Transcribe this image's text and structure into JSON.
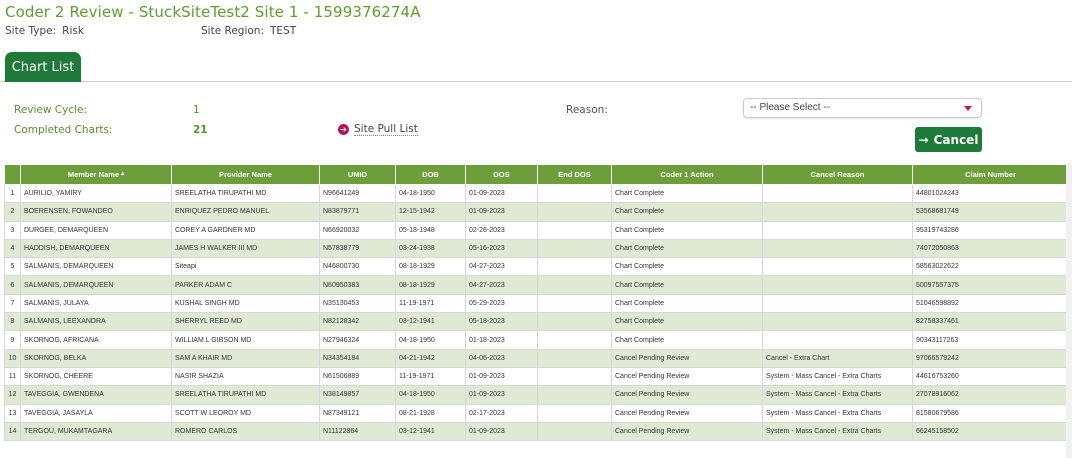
{
  "header": {
    "title": "Coder 2 Review - StuckSiteTest2 Site 1 - 1599376274A",
    "site_type_label": "Site Type:",
    "site_type_value": "Risk",
    "site_region_label": "Site Region:",
    "site_region_value": "TEST"
  },
  "tab": {
    "label": "Chart List"
  },
  "info": {
    "review_cycle_label": "Review Cycle:",
    "review_cycle_value": "1",
    "completed_charts_label": "Completed Charts:",
    "completed_charts_value": "21",
    "site_pull_list_label": "Site Pull List",
    "reason_label": "Reason:",
    "reason_selected": "-- Please Select --",
    "cancel_label": "Cancel"
  },
  "table": {
    "columns": [
      "",
      "Member Name",
      "Provider Name",
      "UMID",
      "DOB",
      "DOS",
      "End DOS",
      "Coder 1 Action",
      "Cancel Reason",
      "Claim Number"
    ],
    "rows": [
      [
        "1",
        "AURILIO, YAMIRY",
        "SREELATHA TIRUPATHI MD",
        "N96641249",
        "04-18-1950",
        "01-09-2023",
        "",
        "Chart Complete",
        "",
        "44801024243"
      ],
      [
        "2",
        "BOERENSEN, FOWANDEO",
        "ENRIQUEZ PEDRO MANUEL",
        "N83879771",
        "12-15-1942",
        "01-09-2023",
        "",
        "Chart Complete",
        "",
        "53568681749"
      ],
      [
        "3",
        "DURGEE, DEMARQUEEN",
        "COREY A GARDNER MD",
        "N66920032",
        "05-18-1948",
        "02-26-2023",
        "",
        "Chart Complete",
        "",
        "95319743286"
      ],
      [
        "4",
        "HADDISH, DEMARQUEEN",
        "JAMES H WALKER III MD",
        "N57838779",
        "03-24-1938",
        "05-16-2023",
        "",
        "Chart Complete",
        "",
        "74072050863"
      ],
      [
        "5",
        "SALMANIS, DEMARQUEEN",
        "Siteapi",
        "N46800730",
        "08-18-1929",
        "04-27-2023",
        "",
        "Chart Complete",
        "",
        "58563022622"
      ],
      [
        "6",
        "SALMANIS, DEMARQUEEN",
        "PARKER ADAM C",
        "N60950383",
        "08-18-1929",
        "04-27-2023",
        "",
        "Chart Complete",
        "",
        "50097557375"
      ],
      [
        "7",
        "SALMANIS, JULAYA",
        "KUSHAL SINGH MD",
        "N35130453",
        "11-19-1971",
        "05-29-2023",
        "",
        "Chart Complete",
        "",
        "51046598892"
      ],
      [
        "8",
        "SALMANIS, LEEXANDRA",
        "SHERRYL REED MD",
        "N82128342",
        "03-12-1941",
        "05-18-2023",
        "",
        "Chart Complete",
        "",
        "82758337461"
      ],
      [
        "9",
        "SKORNOG, AFRICANA",
        "WILLIAM L GIBSON MD",
        "N27946324",
        "04-18-1950",
        "01-18-2023",
        "",
        "Chart Complete",
        "",
        "90343117263"
      ],
      [
        "10",
        "SKORNOG, BELKA",
        "SAM A KHAIR MD",
        "N34354184",
        "04-21-1942",
        "04-06-2023",
        "",
        "Cancel Pending Review",
        "Cancel - Extra Chart",
        "97066579242"
      ],
      [
        "11",
        "SKORNOG, CHEERE",
        "NASIR SHAZIA",
        "N61506889",
        "11-19-1971",
        "01-09-2023",
        "",
        "Cancel Pending Review",
        "System - Mass Cancel - Extra Charts",
        "44616753260"
      ],
      [
        "12",
        "TAVEGGIA, GWENDENA",
        "SREELATHA TIRUPATHI MD",
        "N38149857",
        "04-18-1950",
        "01-09-2023",
        "",
        "Cancel Pending Review",
        "System - Mass Cancel - Extra Charts",
        "27078916062"
      ],
      [
        "13",
        "TAVEGGIA, JASAYLA",
        "SCOTT W LEOROY MD",
        "N87349121",
        "08-21-1928",
        "02-17-2023",
        "",
        "Cancel Pending Review",
        "System - Mass Cancel - Extra Charts",
        "81580679586"
      ],
      [
        "14",
        "TERGOU, MUKAMTAGARA",
        "ROMERO CARLOS",
        "N11122864",
        "03-12-1941",
        "01-09-2023",
        "",
        "Cancel Pending Review",
        "System - Mass Cancel - Extra Charts",
        "66245158502"
      ]
    ]
  }
}
